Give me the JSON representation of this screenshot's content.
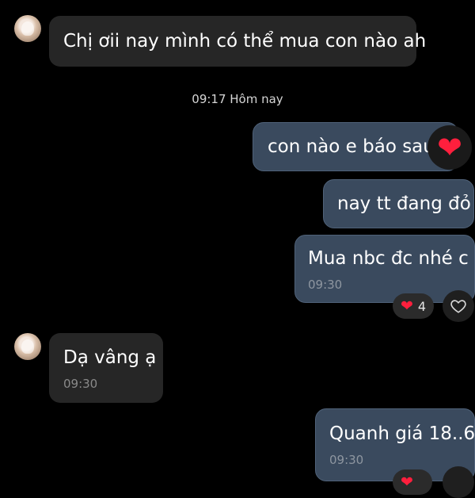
{
  "messages": {
    "m1": {
      "text": "Chị ơii nay mình có thể mua con nào ah"
    },
    "divider": {
      "text": "09:17 Hôm nay"
    },
    "m2": {
      "text": "con nào e báo sau"
    },
    "m3": {
      "text": "nay tt đang đỏ"
    },
    "m4": {
      "text": "Mua nbc đc nhé c",
      "time": "09:30",
      "reaction_count": "4"
    },
    "m5": {
      "text": "Dạ vâng ạ",
      "time": "09:30"
    },
    "m6": {
      "text": "Quanh giá 18..6",
      "time": "09:30"
    }
  },
  "icons": {
    "heart": "heart-icon",
    "like": "heart-outline-icon"
  },
  "colors": {
    "background": "#000000",
    "incoming_bubble": "#262626",
    "outgoing_bubble": "#3a4a5e",
    "heart": "#ff1f3d"
  }
}
